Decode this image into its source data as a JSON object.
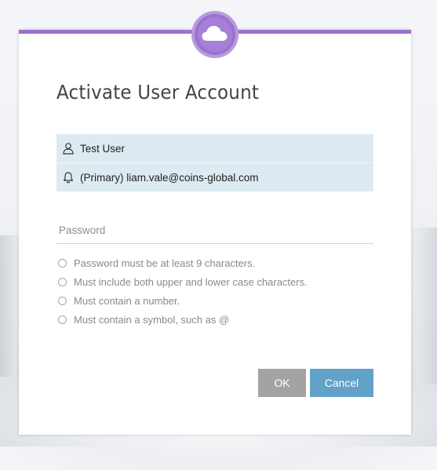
{
  "dialog": {
    "title": "Activate User Account",
    "accent_color": "#9b72cf",
    "logo_icon": "cloud-icon"
  },
  "user": {
    "name": "Test User",
    "name_icon": "user-icon",
    "email": "(Primary) liam.vale@coins-global.com",
    "email_icon": "bell-icon"
  },
  "password": {
    "value": "",
    "placeholder": "Password"
  },
  "rules": [
    "Password must be at least 9 characters.",
    "Must include both upper and lower case characters.",
    "Must contain a number.",
    "Must contain a symbol, such as @"
  ],
  "buttons": {
    "ok_label": "OK",
    "cancel_label": "Cancel",
    "ok_color": "#a3a3a3",
    "cancel_color": "#62a1c8"
  }
}
